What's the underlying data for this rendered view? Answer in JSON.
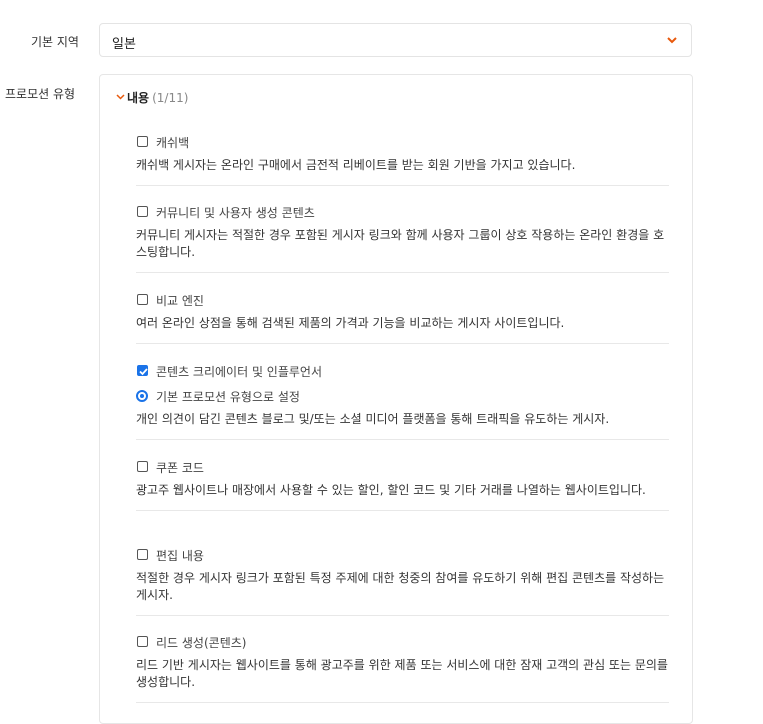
{
  "form": {
    "region_label": "기본 지역",
    "region_value": "일본",
    "promo_label": "프로모션 유형"
  },
  "section": {
    "title": "내용",
    "count": "(1/11)"
  },
  "items": [
    {
      "label": "캐쉬백",
      "checked": false,
      "description": "캐쉬백 게시자는 온라인 구매에서 금전적 리베이트를 받는 회원 기반을 가지고 있습니다."
    },
    {
      "label": "커뮤니티 및 사용자 생성 콘텐츠",
      "checked": false,
      "description": "커뮤니티 게시자는 적절한 경우 포함된 게시자 링크와 함께 사용자 그룹이 상호 작용하는 온라인 환경을 호스팅합니다."
    },
    {
      "label": "비교 엔진",
      "checked": false,
      "description": "여러 온라인 상점을 통해 검색된 제품의 가격과 기능을 비교하는 게시자 사이트입니다."
    },
    {
      "label": "콘텐츠 크리에이터 및 인플루언서",
      "checked": true,
      "radio_label": "기본 프로모션 유형으로 설정",
      "description": "개인 의견이 담긴 콘텐츠 블로그 및/또는 소셜 미디어 플랫폼을 통해 트래픽을 유도하는 게시자."
    },
    {
      "label": "쿠폰 코드",
      "checked": false,
      "description": "광고주 웹사이트나 매장에서 사용할 수 있는 할인, 할인 코드 및 기타 거래를 나열하는 웹사이트입니다."
    },
    {
      "label": "편집 내용",
      "checked": false,
      "description": "적절한 경우 게시자 링크가 포함된 특정 주제에 대한 청중의 참여를 유도하기 위해 편집 콘텐츠를 작성하는 게시자."
    },
    {
      "label": "리드 생성(콘텐츠)",
      "checked": false,
      "description": "리드 기반 게시자는 웹사이트를 통해 광고주를 위한 제품 또는 서비스에 대한 잠재 고객의 관심 또는 문의를 생성합니다."
    }
  ],
  "colors": {
    "accent": "#e8590c",
    "checkbox": "#1a73e8"
  }
}
